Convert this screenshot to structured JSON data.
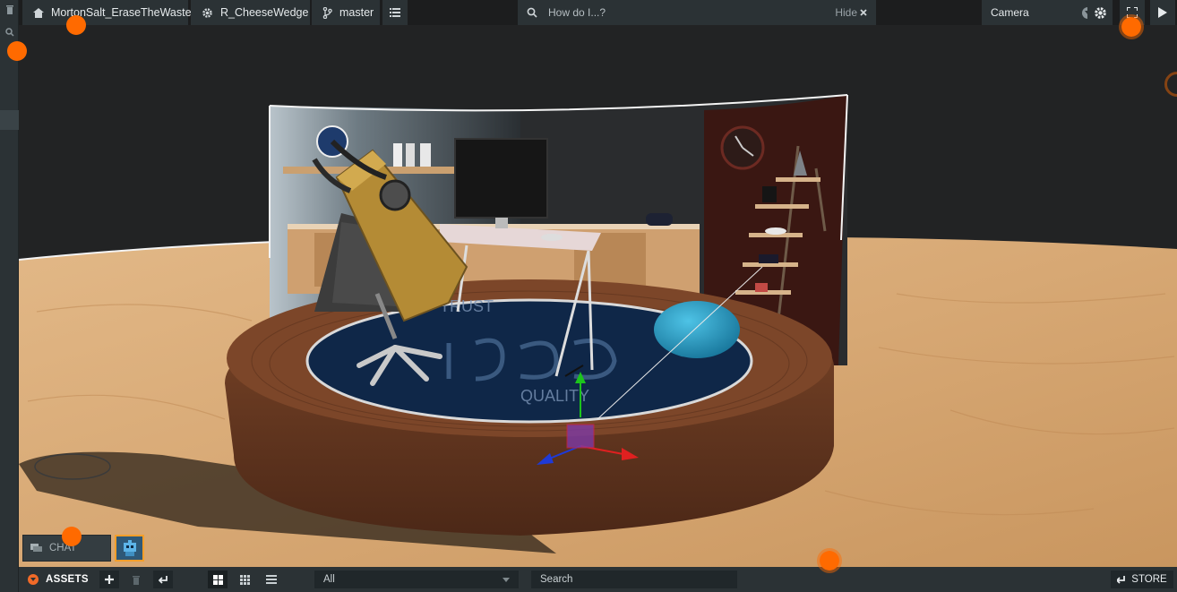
{
  "topbar": {
    "project_name": "MortonSalt_EraseTheWaste",
    "scene_name": "R_CheeseWedge",
    "branch_name": "master",
    "search_placeholder": "How do I...?",
    "hide_label": "Hide",
    "camera_value": "Camera"
  },
  "bottombar": {
    "assets_label": "ASSETS",
    "filter_value": "All",
    "search_placeholder": "Search",
    "store_label": "STORE"
  },
  "chat": {
    "label": "CHAT"
  },
  "icons": {
    "home": "home-icon",
    "settings": "gear-icon",
    "branch": "branch-icon",
    "list": "list-icon",
    "search": "search-icon",
    "close": "close-icon",
    "fullscreen": "fullscreen-icon",
    "play": "play-icon",
    "add": "plus-icon",
    "delete": "trash-icon",
    "swap": "swap-icon",
    "grid_large": "grid-large-icon",
    "grid_small": "grid-small-icon",
    "list_view": "list-view-icon",
    "store": "store-icon",
    "chat": "chat-icon"
  },
  "colors": {
    "panel": "#2b3235",
    "accent": "#f16a28",
    "floor": "#d6aa79",
    "platform": "#6e3d24",
    "rug": "#0f2748",
    "recording_dot": "#ff6a00"
  }
}
